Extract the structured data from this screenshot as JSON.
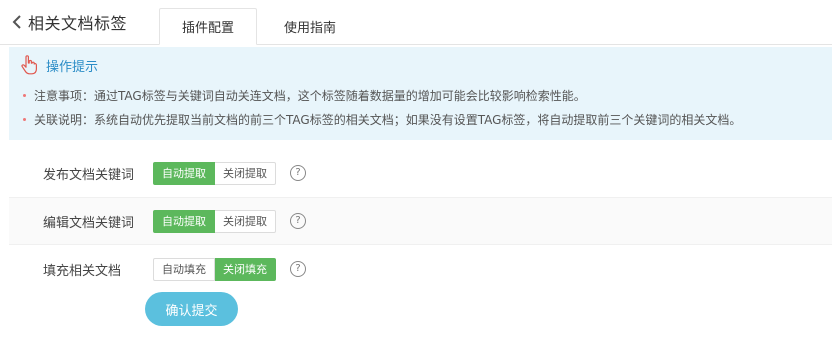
{
  "header": {
    "title": "相关文档标签",
    "tabs": [
      {
        "label": "插件配置",
        "active": true
      },
      {
        "label": "使用指南",
        "active": false
      }
    ]
  },
  "tips": {
    "heading": "操作提示",
    "lines": [
      "注意事项：通过TAG标签与关键词自动关连文档，这个标签随着数据量的增加可能会比较影响检索性能。",
      "关联说明：系统自动优先提取当前文档的前三个TAG标签的相关文档；如果没有设置TAG标签，将自动提取前三个关键词的相关文档。"
    ]
  },
  "form": {
    "rows": [
      {
        "label": "发布文档关键词",
        "options": [
          "自动提取",
          "关闭提取"
        ],
        "selected": "自动提取"
      },
      {
        "label": "编辑文档关键词",
        "options": [
          "自动提取",
          "关闭提取"
        ],
        "selected": "自动提取"
      },
      {
        "label": "填充相关文档",
        "options": [
          "自动填充",
          "关闭填充"
        ],
        "selected": "关闭填充"
      }
    ],
    "help_glyph": "?",
    "submit_label": "确认提交"
  },
  "colors": {
    "accent_green": "#5cb85c",
    "submit_blue": "#5bc0de",
    "tip_bg": "#e8f5fb",
    "tip_heading": "#2b8dc7"
  },
  "icons": [
    "chevron-left-icon",
    "pointer-hand-icon",
    "help-circle-icon"
  ]
}
